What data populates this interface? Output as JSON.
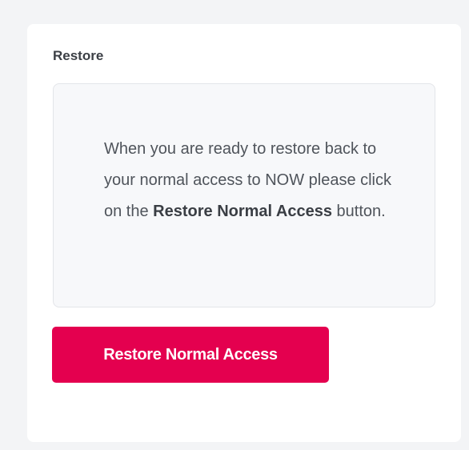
{
  "card": {
    "title": "Restore"
  },
  "info": {
    "text_before": "When you are ready to restore back to your normal access to NOW please click on the ",
    "text_bold": "Restore Normal Access",
    "text_after": " button."
  },
  "button": {
    "label": "Restore Normal Access"
  },
  "colors": {
    "accent": "#e4004f",
    "page_background": "#f3f4f6",
    "card_background": "#ffffff",
    "info_background": "#f7f8fa"
  }
}
